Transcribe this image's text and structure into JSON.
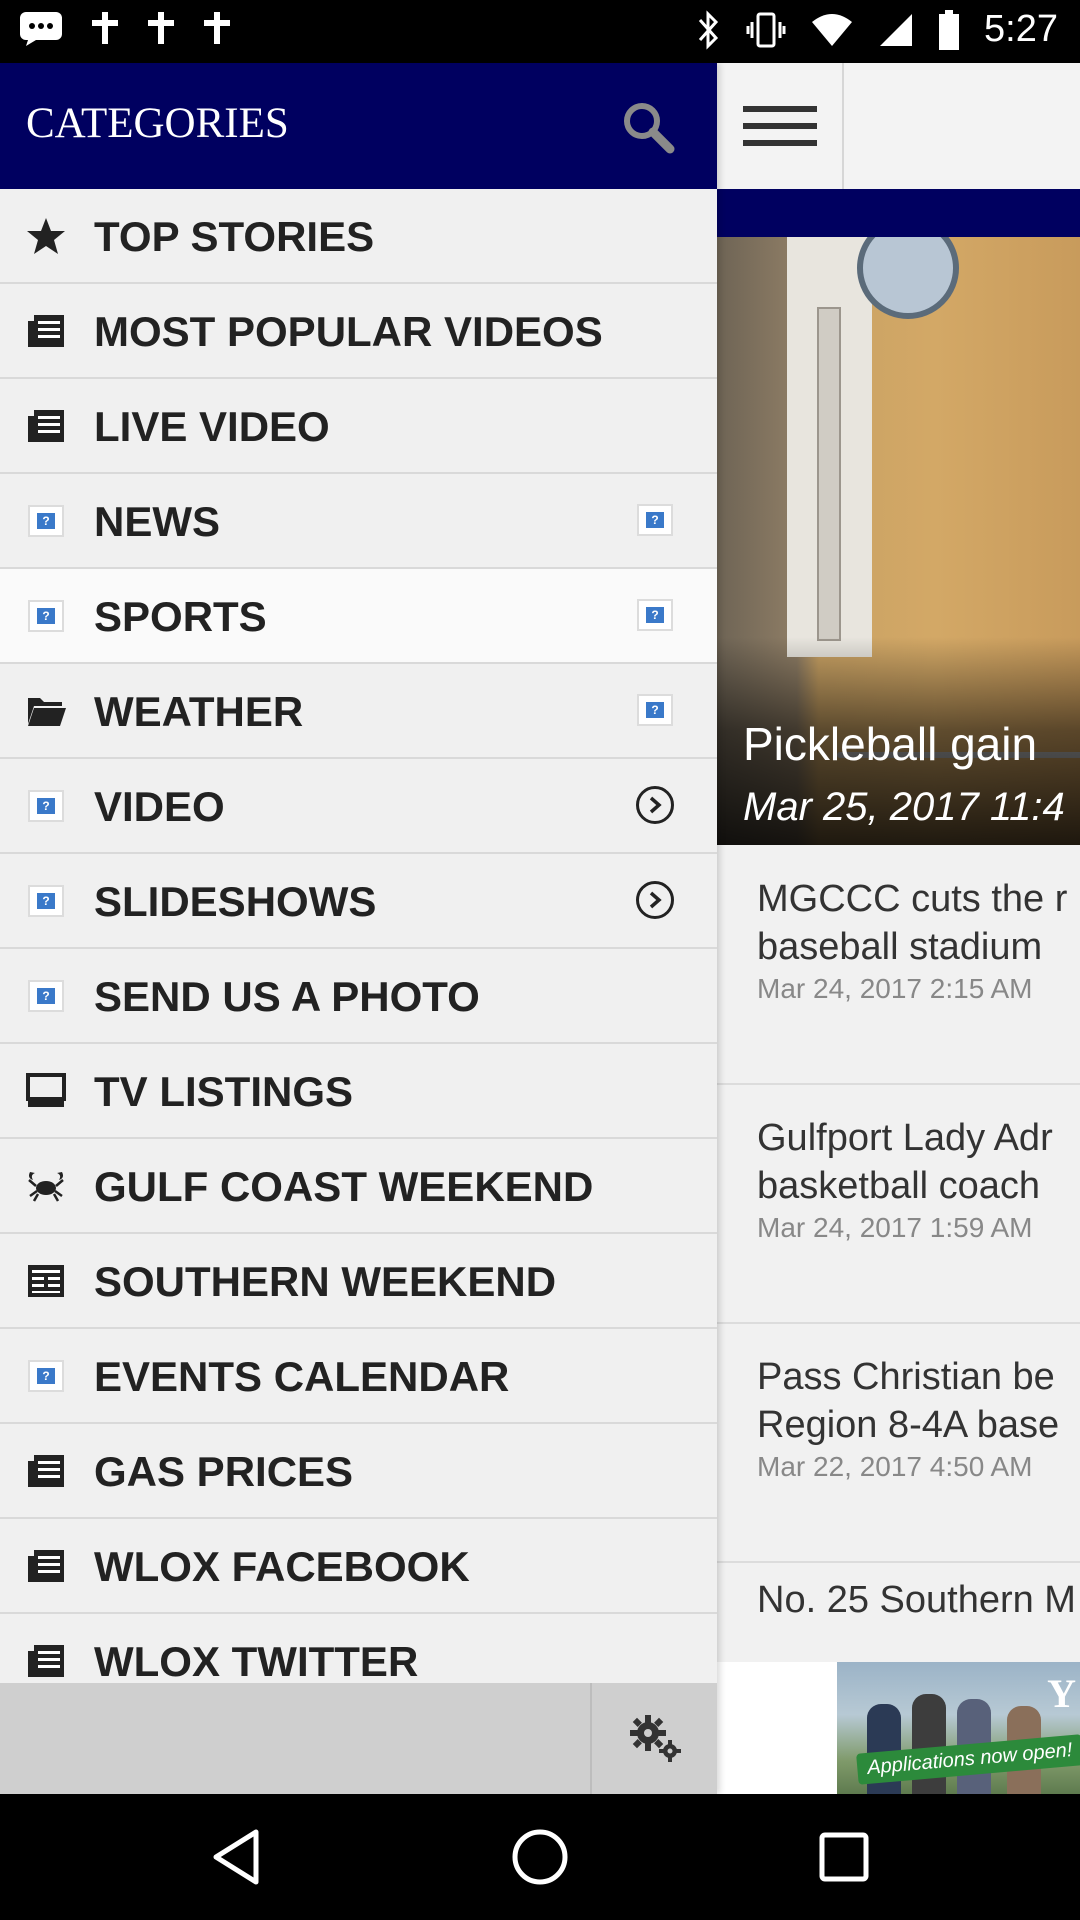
{
  "status_bar": {
    "time": "5:27",
    "icons": [
      "message-icon",
      "notification-icon",
      "notification-icon",
      "notification-icon",
      "bluetooth-icon",
      "vibrate-icon",
      "wifi-icon",
      "signal-icon",
      "battery-icon"
    ]
  },
  "drawer": {
    "title": "CATEGORIES",
    "items": [
      {
        "label": "TOP STORIES",
        "icon": "star-icon",
        "trailing": null
      },
      {
        "label": "MOST POPULAR VIDEOS",
        "icon": "document-icon",
        "trailing": null
      },
      {
        "label": "LIVE VIDEO",
        "icon": "document-icon",
        "trailing": null
      },
      {
        "label": "NEWS",
        "icon": "placeholder-image-icon",
        "trailing": "placeholder-image-icon"
      },
      {
        "label": "SPORTS",
        "icon": "placeholder-image-icon",
        "trailing": "placeholder-image-icon",
        "selected": true
      },
      {
        "label": "WEATHER",
        "icon": "folder-icon",
        "trailing": "placeholder-image-icon"
      },
      {
        "label": "VIDEO",
        "icon": "placeholder-image-icon",
        "trailing": "chevron-right-icon"
      },
      {
        "label": "SLIDESHOWS",
        "icon": "placeholder-image-icon",
        "trailing": "chevron-right-icon"
      },
      {
        "label": "SEND US A PHOTO",
        "icon": "placeholder-image-icon",
        "trailing": null
      },
      {
        "label": "TV LISTINGS",
        "icon": "tv-icon",
        "trailing": null
      },
      {
        "label": "GULF COAST WEEKEND",
        "icon": "crab-icon",
        "trailing": null
      },
      {
        "label": "SOUTHERN WEEKEND",
        "icon": "newspaper-icon",
        "trailing": null
      },
      {
        "label": "EVENTS CALENDAR",
        "icon": "placeholder-image-icon",
        "trailing": null
      },
      {
        "label": "GAS PRICES",
        "icon": "document-icon",
        "trailing": null
      },
      {
        "label": "WLOX FACEBOOK",
        "icon": "document-icon",
        "trailing": null
      },
      {
        "label": "WLOX TWITTER",
        "icon": "document-icon",
        "trailing": null
      }
    ]
  },
  "articles": {
    "hero": {
      "title": "Pickleball gain",
      "date": "Mar 25, 2017 11:4"
    },
    "stories": [
      {
        "title": "MGCCC cuts the r\nbaseball stadium",
        "date": "Mar 24, 2017 2:15 AM"
      },
      {
        "title": "Gulfport Lady Adr\nbasketball coach",
        "date": "Mar 24, 2017 1:59 AM"
      },
      {
        "title": "Pass Christian be\nRegion 8-4A base",
        "date": "Mar 22, 2017 4:50 AM"
      },
      {
        "title": "No. 25 Southern M",
        "date": ""
      }
    ]
  },
  "ad": {
    "banner_text": "Applications now open!",
    "corner_letter": "Y"
  },
  "colors": {
    "header_navy": "#000060",
    "drawer_bg": "#f0f0f0",
    "icon_blue": "#3a79c9"
  }
}
